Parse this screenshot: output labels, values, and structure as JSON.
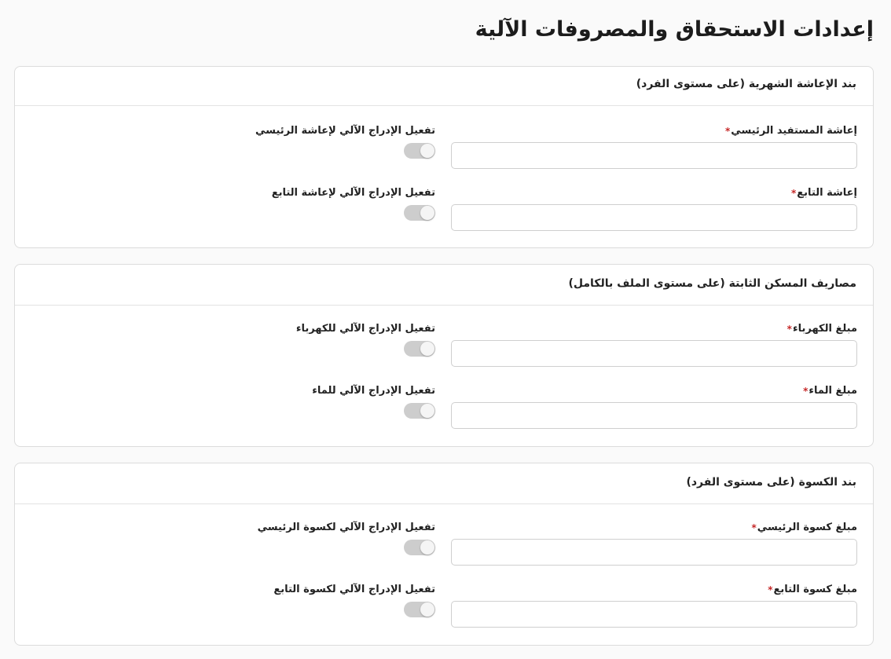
{
  "page": {
    "title": "إعدادات الاستحقاق والمصروفات الآلية"
  },
  "colors": {
    "required_marker": "#c62828",
    "toggle_off_track": "#cdcdcd",
    "card_border": "#dcdcdc",
    "background": "#fafafa"
  },
  "sections": [
    {
      "title": "بند الإعاشة الشهرية (على مستوى الفرد)",
      "fields": [
        {
          "label": "إعاشة المستفيد الرئيسي",
          "required": true,
          "value": "",
          "toggle_label": "تفعيل الإدراج الآلي لإعاشة الرئيسي",
          "toggle_on": false
        },
        {
          "label": "إعاشة التابع",
          "required": true,
          "value": "",
          "toggle_label": "تفعيل الإدراج الآلي لإعاشة التابع",
          "toggle_on": false
        }
      ]
    },
    {
      "title": "مصاريف المسكن الثابتة (على مستوى الملف بالكامل)",
      "fields": [
        {
          "label": "مبلغ الكهرباء",
          "required": true,
          "value": "",
          "toggle_label": "تفعيل الإدراج الآلي للكهرباء",
          "toggle_on": false
        },
        {
          "label": "مبلغ الماء",
          "required": true,
          "value": "",
          "toggle_label": "تفعيل الإدراج الآلي للماء",
          "toggle_on": false
        }
      ]
    },
    {
      "title": "بند الكسوة (على مستوى الفرد)",
      "fields": [
        {
          "label": "مبلغ كسوة الرئيسي",
          "required": true,
          "value": "",
          "toggle_label": "تفعيل الإدراج الآلي لكسوة الرئيسي",
          "toggle_on": false
        },
        {
          "label": "مبلغ كسوة التابع",
          "required": true,
          "value": "",
          "toggle_label": "تفعيل الإدراج الآلي لكسوة التابع",
          "toggle_on": false
        }
      ]
    }
  ]
}
